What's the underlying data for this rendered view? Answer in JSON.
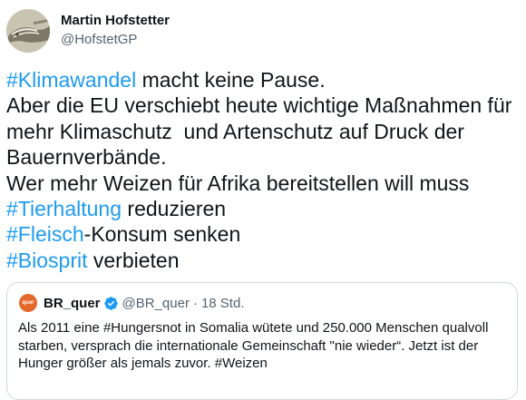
{
  "author": {
    "name": "Martin Hofstetter",
    "handle": "@HofstetGP"
  },
  "tweet": {
    "line1_tag": "#Klimawandel",
    "line1_rest": " macht keine Pause.",
    "line2": "Aber die EU verschiebt heute wichtige Maßnahmen für mehr Klimaschutz  und Artenschutz auf Druck der Bauernverbände.",
    "line3": "Wer mehr Weizen für Afrika bereitstellen will muss",
    "line4_tag": "#Tierhaltung",
    "line4_rest": " reduzieren",
    "line5_tag": "#Fleisch",
    "line5_rest": "-Konsum senken",
    "line6_tag": "#Biosprit",
    "line6_rest": " verbieten"
  },
  "quote": {
    "avatar_text": "quer",
    "name": "BR_quer",
    "handle": "@BR_quer",
    "separator": "·",
    "time": "18 Std.",
    "text": "Als 2011 eine #Hungersnot in Somalia wütete und 250.000 Menschen qualvoll starben, versprach die internationale Gemeinschaft \"nie wieder“. Jetzt ist der Hunger größer als jemals zuvor. #Weizen"
  },
  "colors": {
    "hashtag": "#1d9bf0",
    "verified": "#1d9bf0",
    "secondary_text": "#536471"
  },
  "icons": {
    "verified": "verified-badge-icon",
    "avatar": "avatar-image"
  }
}
